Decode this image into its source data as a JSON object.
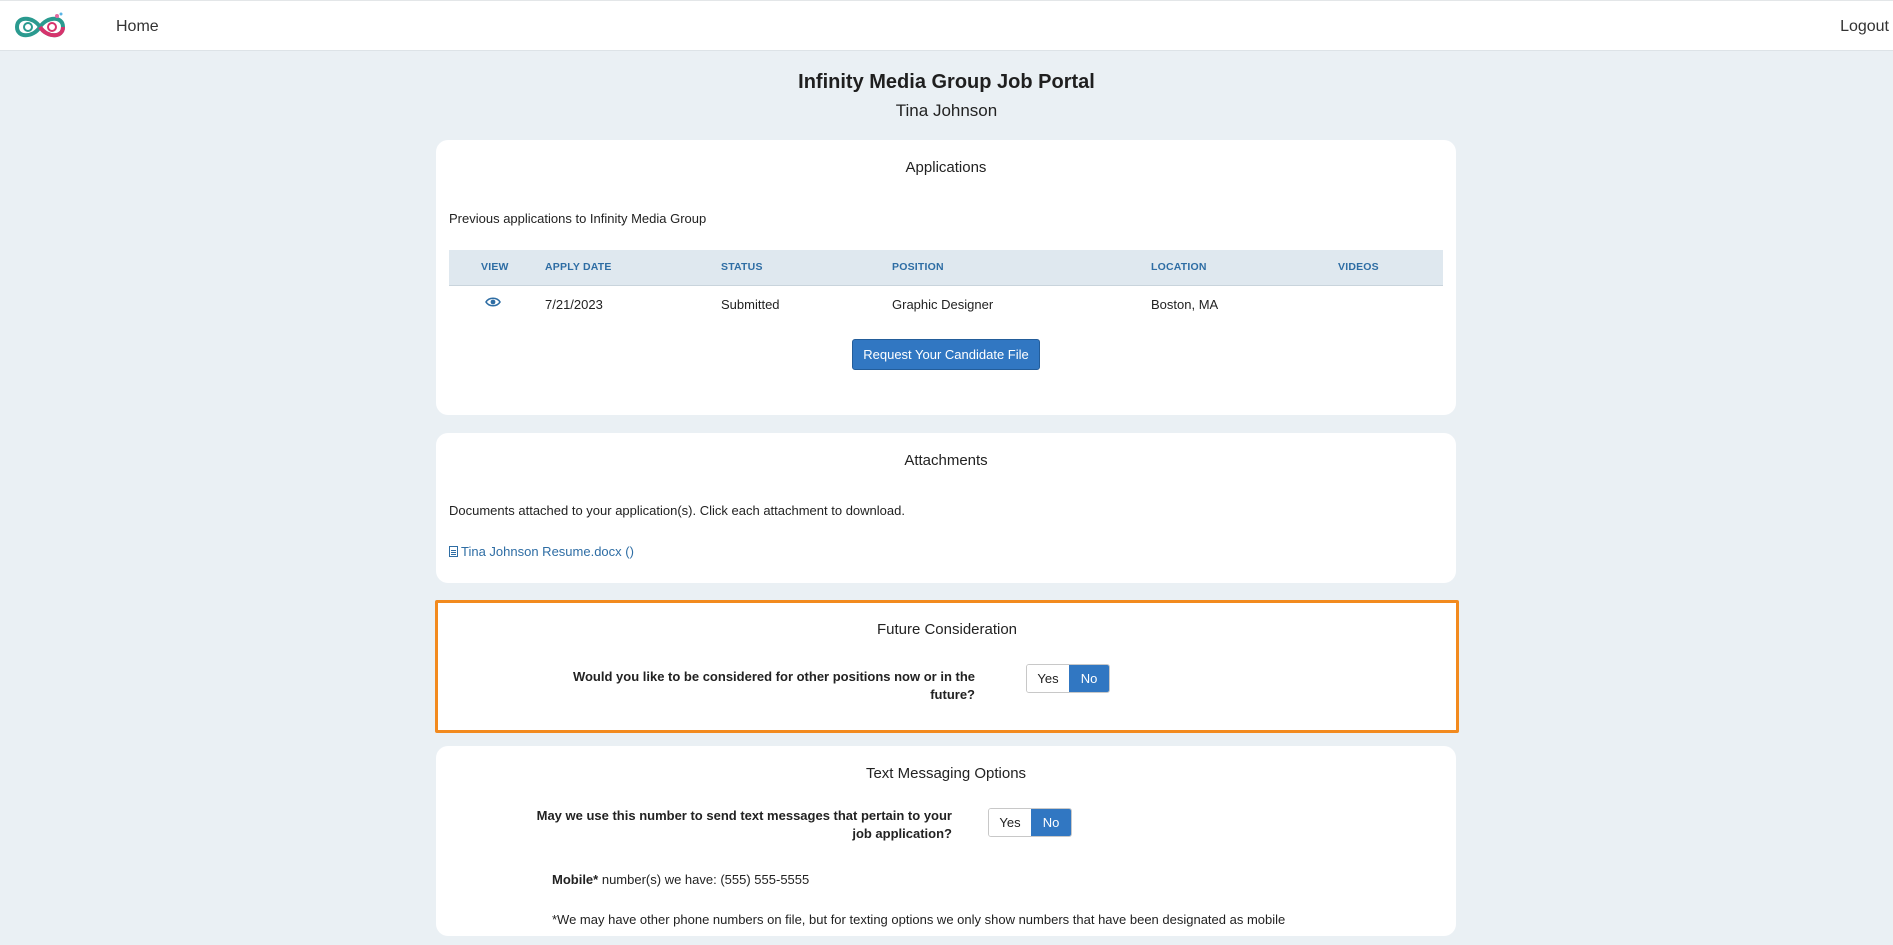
{
  "nav": {
    "home": "Home",
    "logout": "Logout"
  },
  "header": {
    "title": "Infinity Media Group Job Portal",
    "user": "Tina Johnson"
  },
  "applications": {
    "title": "Applications",
    "subtitle": "Previous applications to Infinity Media Group",
    "columns": [
      "VIEW",
      "APPLY DATE",
      "STATUS",
      "POSITION",
      "LOCATION",
      "VIDEOS"
    ],
    "rows": [
      {
        "apply_date": "7/21/2023",
        "status": "Submitted",
        "position": "Graphic Designer",
        "location": "Boston, MA",
        "videos": ""
      }
    ],
    "request_button": "Request Your Candidate File"
  },
  "attachments": {
    "title": "Attachments",
    "subtitle": "Documents attached to your application(s). Click each attachment to download.",
    "files": [
      "Tina Johnson Resume.docx ()"
    ]
  },
  "future": {
    "title": "Future Consideration",
    "question": "Would you like to be considered for other positions now or in the future?",
    "yes": "Yes",
    "no": "No",
    "selected": "No"
  },
  "text_messaging": {
    "title": "Text Messaging Options",
    "question": "May we use this number to send text messages that pertain to your job application?",
    "yes": "Yes",
    "no": "No",
    "selected": "No",
    "mobile_label": "Mobile*",
    "mobile_text": " number(s) we have: (555) 555-5555",
    "note": "*We may have other phone numbers on file, but for texting options we only show numbers that have been designated as mobile"
  },
  "colors": {
    "accent": "#3177c2",
    "highlight_border": "#f28a1e",
    "background": "#eaf0f4"
  }
}
